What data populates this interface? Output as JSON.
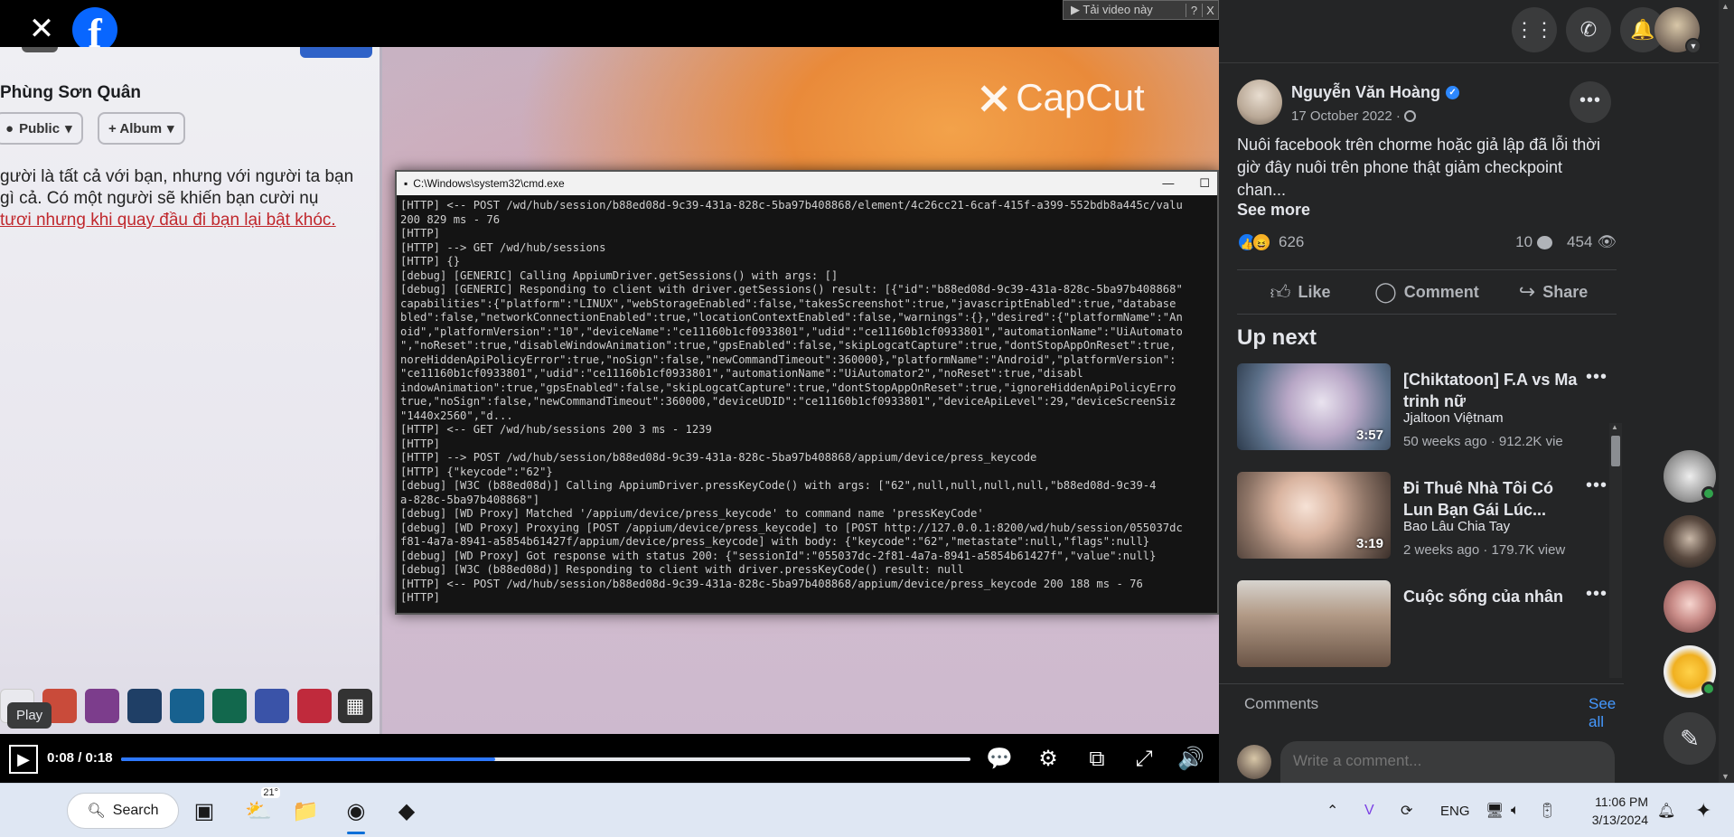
{
  "video": {
    "close_icon": "close-icon",
    "download_bar": {
      "label": "▶ Tải video này",
      "help": "?",
      "close": "X"
    },
    "left_panel": {
      "name": "Phùng Sơn Quân",
      "chip_public": "Public",
      "chip_album": "+ Album",
      "text_line1": "gười là tất cả với bạn, nhưng với người ta bạn",
      "text_line2": "gì cả. Có một người sẽ khiến bạn cười  nụ",
      "text_line3": "tươi nhưng khi quay đầu đi bạn lại bật khóc."
    },
    "watermark": "CapCut",
    "cmd_title": "C:\\Windows\\system32\\cmd.exe",
    "cmd_lines": [
      "[HTTP] <-- POST /wd/hub/session/b88ed08d-9c39-431a-828c-5ba97b408868/element/4c26cc21-6caf-415f-a399-552bdb8a445c/valu",
      "200 829 ms - 76",
      "[HTTP]",
      "[HTTP] --> GET /wd/hub/sessions",
      "[HTTP] {}",
      "[debug] [GENERIC] Calling AppiumDriver.getSessions() with args: []",
      "[debug] [GENERIC] Responding to client with driver.getSessions() result: [{\"id\":\"b88ed08d-9c39-431a-828c-5ba97b408868\"",
      "capabilities\":{\"platform\":\"LINUX\",\"webStorageEnabled\":false,\"takesScreenshot\":true,\"javascriptEnabled\":true,\"database",
      "bled\":false,\"networkConnectionEnabled\":true,\"locationContextEnabled\":false,\"warnings\":{},\"desired\":{\"platformName\":\"An",
      "oid\",\"platformVersion\":\"10\",\"deviceName\":\"ce11160b1cf0933801\",\"udid\":\"ce11160b1cf0933801\",\"automationName\":\"UiAutomato",
      "\",\"noReset\":true,\"disableWindowAnimation\":true,\"gpsEnabled\":false,\"skipLogcatCapture\":true,\"dontStopAppOnReset\":true,",
      "noreHiddenApiPolicyError\":true,\"noSign\":false,\"newCommandTimeout\":360000},\"platformName\":\"Android\",\"platformVersion\":",
      "\"ce11160b1cf0933801\",\"udid\":\"ce11160b1cf0933801\",\"automationName\":\"UiAutomator2\",\"noReset\":true,\"disabl",
      "indowAnimation\":true,\"gpsEnabled\":false,\"skipLogcatCapture\":true,\"dontStopAppOnReset\":true,\"ignoreHiddenApiPolicyErro",
      "true,\"noSign\":false,\"newCommandTimeout\":360000,\"deviceUDID\":\"ce11160b1cf0933801\",\"deviceApiLevel\":29,\"deviceScreenSiz",
      "\"1440x2560\",\"d...",
      "[HTTP] <-- GET /wd/hub/sessions 200 3 ms - 1239",
      "[HTTP]",
      "[HTTP] --> POST /wd/hub/session/b88ed08d-9c39-431a-828c-5ba97b408868/appium/device/press_keycode",
      "[HTTP] {\"keycode\":\"62\"}",
      "[debug] [W3C (b88ed08d)] Calling AppiumDriver.pressKeyCode() with args: [\"62\",null,null,null,null,\"b88ed08d-9c39-4",
      "a-828c-5ba97b408868\"]",
      "[debug] [WD Proxy] Matched '/appium/device/press_keycode' to command name 'pressKeyCode'",
      "[debug] [WD Proxy] Proxying [POST /appium/device/press_keycode] to [POST http://127.0.0.1:8200/wd/hub/session/055037dc",
      "f81-4a7a-8941-a5854b61427f/appium/device/press_keycode] with body: {\"keycode\":\"62\",\"metastate\":null,\"flags\":null}",
      "[debug] [WD Proxy] Got response with status 200: {\"sessionId\":\"055037dc-2f81-4a7a-8941-a5854b61427f\",\"value\":null}",
      "[debug] [W3C (b88ed08d)] Responding to client with driver.pressKeyCode() result: null",
      "[HTTP] <-- POST /wd/hub/session/b88ed08d-9c39-431a-828c-5ba97b408868/appium/device/press_keycode 200 188 ms - 76",
      "[HTTP]"
    ],
    "play_tooltip": "Play",
    "time": "0:08 / 0:18",
    "progress_fraction": 0.44
  },
  "header": {
    "menu_icon": "grid-menu-icon",
    "messenger_icon": "messenger-icon",
    "notifications_icon": "bell-icon"
  },
  "post": {
    "author": "Nguyễn Văn Hoàng",
    "date": "17 October 2022 ·",
    "text": "Nuôi facebook trên chorme hoặc giả lập đã lỗi thời giờ đây nuôi trên phone thật giảm checkpoint chan...",
    "see_more": "See more",
    "reaction_count": "626",
    "comment_count": "10",
    "view_count": "454",
    "actions": {
      "like": "Like",
      "comment": "Comment",
      "share": "Share"
    }
  },
  "up_next": {
    "title": "Up next",
    "videos": [
      {
        "title": "[Chiktatoon] F.A vs Ma trinh nữ",
        "channel": "Jjaltoon Việtnam",
        "meta": "50 weeks ago · 912.2K vie",
        "duration": "3:57"
      },
      {
        "title": "Đi Thuê Nhà Tôi Có Lun Bạn Gái Lúc...",
        "channel": "Bao Lâu Chia Tay",
        "meta": "2 weeks ago · 179.7K view",
        "duration": "3:19"
      },
      {
        "title": "Cuộc sống của nhân",
        "channel": "",
        "meta": "",
        "duration": ""
      }
    ]
  },
  "comments": {
    "label": "Comments",
    "see_all": "See all",
    "placeholder": "Write a comment..."
  },
  "taskbar": {
    "search_label": "Search",
    "weather_temp": "21°",
    "lang": "ENG",
    "time": "11:06 PM",
    "date": "3/13/2024"
  }
}
